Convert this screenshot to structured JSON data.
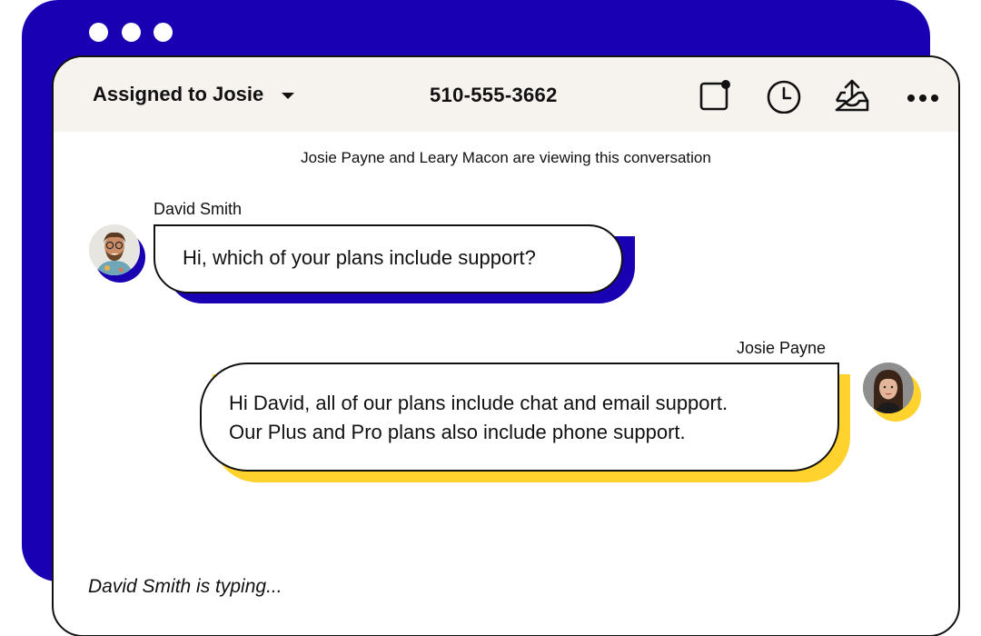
{
  "window": {
    "traffic_dots": [
      "window-dot",
      "window-dot",
      "window-dot"
    ]
  },
  "header": {
    "assignment_label": "Assigned to Josie",
    "phone_number": "510-555-3662",
    "icons": [
      "note-icon",
      "clock-icon",
      "inbox-upload-icon",
      "more-icon"
    ]
  },
  "conversation": {
    "viewing_notice": "Josie Payne and Leary Macon are viewing this conversation",
    "messages": [
      {
        "sender": "David Smith",
        "text": "Hi, which of your plans include support?",
        "side": "left",
        "accent": "#1a00b3"
      },
      {
        "sender": "Josie Payne",
        "text_line1": "Hi David, all of our plans include chat and email support.",
        "text_line2": "Our Plus and Pro plans also include phone support.",
        "side": "right",
        "accent": "#ffd22e"
      }
    ],
    "typing_indicator": "David Smith is typing..."
  },
  "colors": {
    "brand_blue": "#1a00b3",
    "accent_yellow": "#ffd22e",
    "header_bg": "#f6f2ee"
  }
}
